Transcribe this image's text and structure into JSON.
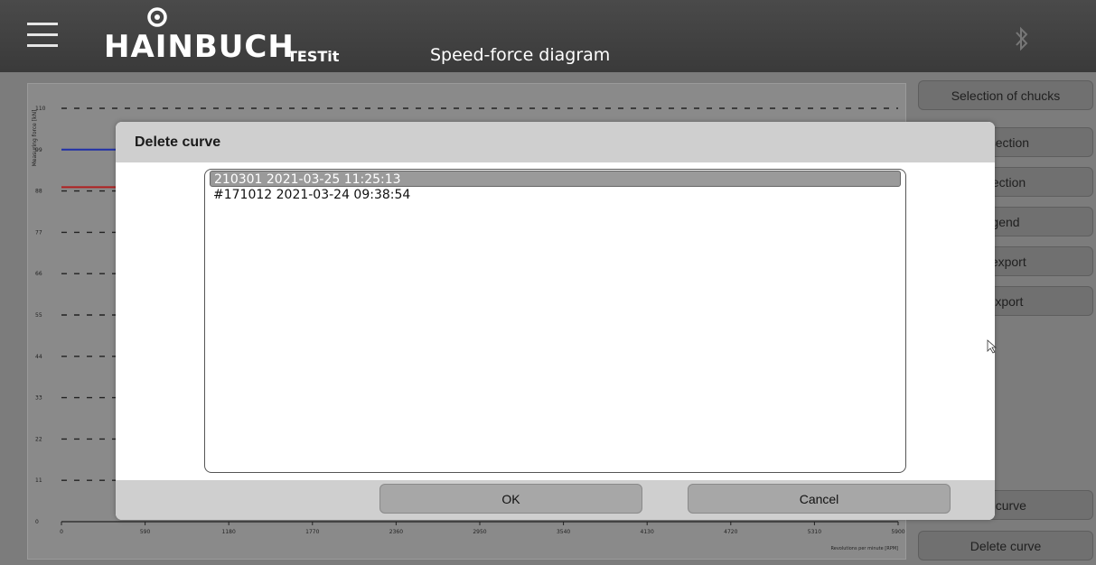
{
  "header": {
    "brand": "HAINBUCH",
    "product": "TESTit",
    "title": "Speed-force diagram",
    "menu_icon": "hamburger-menu-icon",
    "bluetooth_icon": "bluetooth-icon"
  },
  "sidebar": {
    "buttons": [
      {
        "label": "Selection of chucks"
      },
      {
        "label": "t section"
      },
      {
        "label": "section"
      },
      {
        "label": "gend"
      },
      {
        "label": "' export"
      },
      {
        "label": "export"
      },
      {
        "label": "d curve"
      },
      {
        "label": "Delete curve"
      }
    ]
  },
  "chart_data": {
    "type": "line",
    "ylabel": "Measuring force [kN]",
    "xlabel": "Revolutions per minute [RPM]",
    "y_ticks": [
      "110",
      "99",
      "88",
      "77",
      "66",
      "55",
      "44",
      "33",
      "22",
      "11",
      "0"
    ],
    "x_ticks": [
      "0",
      "590",
      "1180",
      "1770",
      "2360",
      "2950",
      "3540",
      "4130",
      "4720",
      "5310",
      "5900"
    ],
    "ylim": [
      0,
      110
    ],
    "xlim": [
      0,
      5900
    ],
    "grid": true,
    "series": [
      {
        "color": "#1f2fa8",
        "x": [
          0,
          400
        ],
        "y": [
          99,
          99
        ]
      },
      {
        "color": "#b02020",
        "x": [
          0,
          380,
          600
        ],
        "y": [
          89,
          89,
          87
        ]
      }
    ]
  },
  "dialog": {
    "title": "Delete curve",
    "items": [
      {
        "label": "210301 2021-03-25 11:25:13",
        "selected": true
      },
      {
        "label": "#171012 2021-03-24 09:38:54",
        "selected": false
      }
    ],
    "ok_label": "OK",
    "cancel_label": "Cancel"
  }
}
